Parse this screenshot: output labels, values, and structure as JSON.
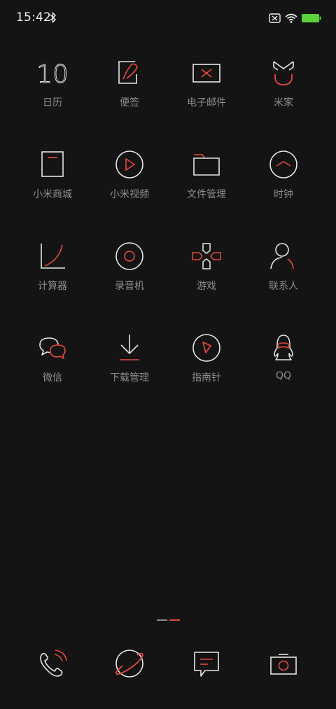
{
  "status_bar": {
    "time": "15:42",
    "icons": [
      "bluetooth-icon",
      "sim-absent-icon",
      "wifi-icon",
      "battery-icon"
    ],
    "battery_color": "#5bd13a"
  },
  "colors": {
    "accent": "#e84a3c",
    "line": "#e6e6e6",
    "label": "#8e8e8e",
    "background": "#141414"
  },
  "apps": [
    {
      "label": "日历",
      "icon": "calendar-icon",
      "icon_text": "10"
    },
    {
      "label": "便签",
      "icon": "notes-icon"
    },
    {
      "label": "电子邮件",
      "icon": "email-icon"
    },
    {
      "label": "米家",
      "icon": "mijia-icon"
    },
    {
      "label": "小米商城",
      "icon": "mi-store-icon"
    },
    {
      "label": "小米视频",
      "icon": "mi-video-icon"
    },
    {
      "label": "文件管理",
      "icon": "folder-icon"
    },
    {
      "label": "时钟",
      "icon": "clock-icon"
    },
    {
      "label": "计算器",
      "icon": "calculator-icon"
    },
    {
      "label": "录音机",
      "icon": "recorder-icon"
    },
    {
      "label": "游戏",
      "icon": "gamepad-icon"
    },
    {
      "label": "联系人",
      "icon": "contacts-icon"
    },
    {
      "label": "微信",
      "icon": "wechat-icon"
    },
    {
      "label": "下载管理",
      "icon": "download-icon"
    },
    {
      "label": "指南针",
      "icon": "compass-icon"
    },
    {
      "label": "QQ",
      "icon": "qq-icon"
    }
  ],
  "page_indicator": {
    "pages": 2,
    "current": 2
  },
  "dock": [
    {
      "icon": "phone-icon"
    },
    {
      "icon": "browser-icon"
    },
    {
      "icon": "messages-icon"
    },
    {
      "icon": "camera-icon"
    }
  ]
}
